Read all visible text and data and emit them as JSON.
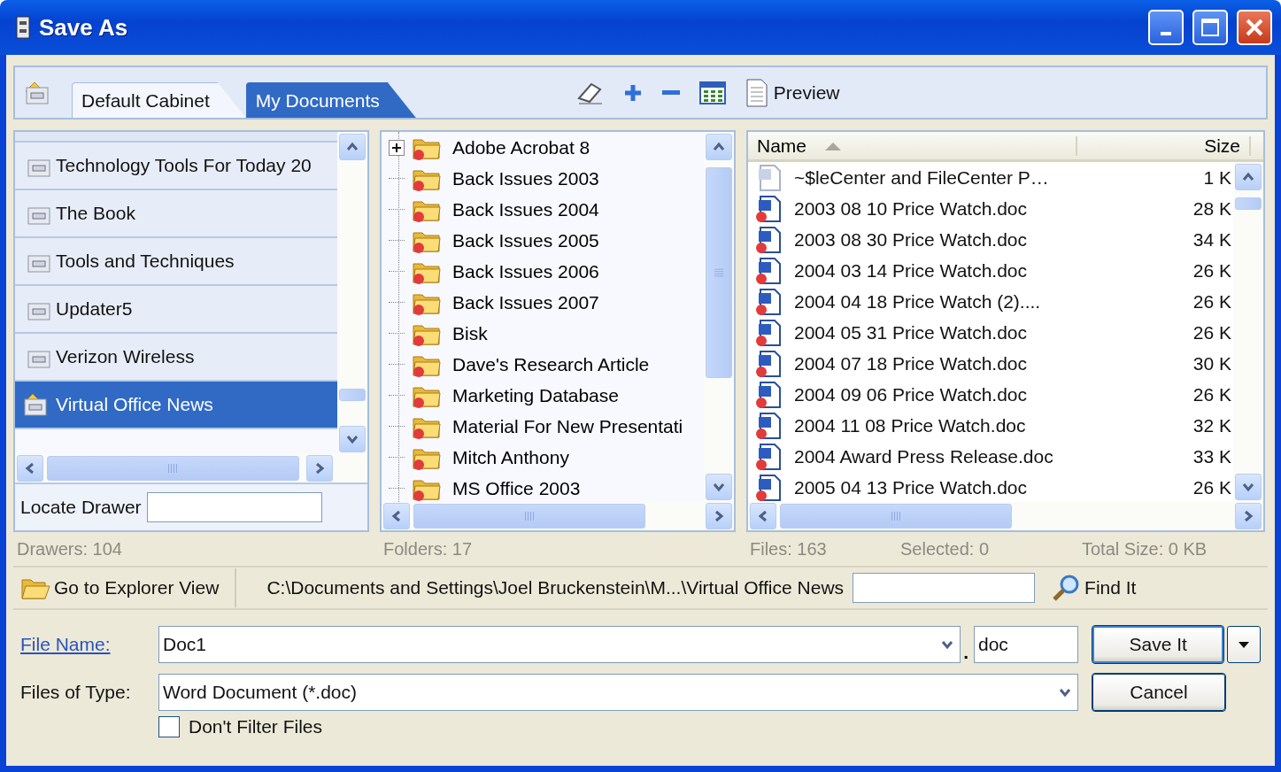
{
  "window": {
    "title": "Save As"
  },
  "cabinet_tabs": [
    {
      "label": "Default Cabinet",
      "selected": false
    },
    {
      "label": "My Documents",
      "selected": true
    }
  ],
  "toolbar": {
    "preview_label": "Preview"
  },
  "drawers": {
    "items": [
      {
        "label": "Technology Tools For Today 20",
        "selected": false
      },
      {
        "label": "The Book",
        "selected": false
      },
      {
        "label": "Tools and Techniques",
        "selected": false
      },
      {
        "label": "Updater5",
        "selected": false
      },
      {
        "label": "Verizon Wireless",
        "selected": false
      },
      {
        "label": "Virtual Office News",
        "selected": true
      }
    ],
    "locate_label": "Locate Drawer",
    "status": "Drawers: 104"
  },
  "folders": {
    "items": [
      {
        "label": "Adobe Acrobat 8",
        "expandable": true
      },
      {
        "label": "Back Issues 2003",
        "expandable": false
      },
      {
        "label": "Back Issues 2004",
        "expandable": false
      },
      {
        "label": "Back Issues 2005",
        "expandable": false
      },
      {
        "label": "Back Issues 2006",
        "expandable": false
      },
      {
        "label": "Back Issues 2007",
        "expandable": false
      },
      {
        "label": "Bisk",
        "expandable": false
      },
      {
        "label": "Dave's Research Article",
        "expandable": false
      },
      {
        "label": "Marketing Database",
        "expandable": false
      },
      {
        "label": "Material For New Presentati",
        "expandable": false
      },
      {
        "label": "Mitch Anthony",
        "expandable": false
      },
      {
        "label": "MS Office 2003",
        "expandable": false
      }
    ],
    "status": "Folders: 17"
  },
  "files": {
    "columns": [
      "Name",
      "Size"
    ],
    "rows": [
      {
        "name": "~$leCenter and FileCenter P…",
        "size": "1 K",
        "kind": "temp"
      },
      {
        "name": "2003 08 10 Price Watch.doc",
        "size": "28 K",
        "kind": "doc"
      },
      {
        "name": "2003 08 30 Price Watch.doc",
        "size": "34 K",
        "kind": "doc"
      },
      {
        "name": "2004 03 14 Price Watch.doc",
        "size": "26 K",
        "kind": "doc"
      },
      {
        "name": "2004 04 18 Price Watch (2)....",
        "size": "26 K",
        "kind": "doc"
      },
      {
        "name": "2004 05 31 Price Watch.doc",
        "size": "26 K",
        "kind": "doc"
      },
      {
        "name": "2004 07 18 Price Watch.doc",
        "size": "30 K",
        "kind": "doc"
      },
      {
        "name": "2004 09 06 Price Watch.doc",
        "size": "26 K",
        "kind": "doc"
      },
      {
        "name": "2004 11 08  Price Watch.doc",
        "size": "32 K",
        "kind": "doc"
      },
      {
        "name": "2004 Award Press Release.doc",
        "size": "33 K",
        "kind": "doc"
      },
      {
        "name": "2005 04 13 Price Watch.doc",
        "size": "26 K",
        "kind": "doc"
      }
    ],
    "status": [
      "Files: 163",
      "Selected: 0",
      "Total Size: 0 KB"
    ]
  },
  "path_bar": {
    "explorer_button": "Go to Explorer View",
    "path": "C:\\Documents and Settings\\Joel Bruckenstein\\M...\\Virtual Office News",
    "find_button": "Find It"
  },
  "form": {
    "file_name_label": "File Name:",
    "file_name": "Doc1",
    "extension_dot": ".",
    "extension": "doc",
    "save_button": "Save It",
    "cancel_button": "Cancel",
    "type_label": "Files of Type:",
    "file_type": "Word Document (*.doc)",
    "filter_label": "Don't Filter Files",
    "filter_checked": false
  }
}
